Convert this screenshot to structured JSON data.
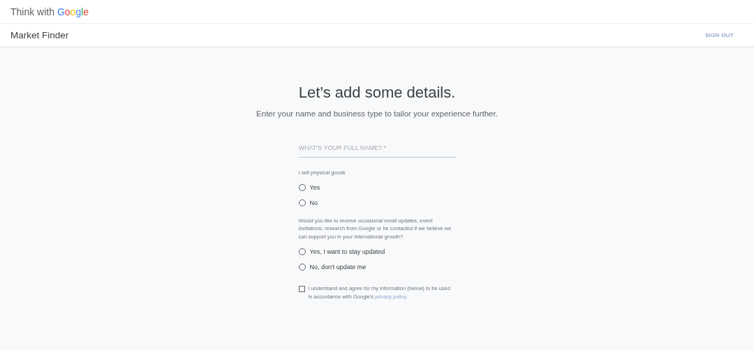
{
  "brand": {
    "prefix": "Think with",
    "name": "Google"
  },
  "app_bar": {
    "title": "Market Finder",
    "sign_out": "SIGN OUT"
  },
  "heading": "Let’s add some details.",
  "subheading": "Enter your name and business type to tailor your experience further.",
  "name_field": {
    "placeholder": "WHAT'S YOUR FULL NAME? *"
  },
  "goods_question": {
    "label": "I sell physical goods",
    "options": [
      {
        "label": "Yes",
        "selected": false
      },
      {
        "label": "No",
        "selected": false
      }
    ]
  },
  "updates_question": {
    "label": "Would you like to receive occasional email updates, event invitations, research from Google or be contacted if we believe we can support you in your international growth?",
    "options": [
      {
        "label": "Yes, I want to stay updated",
        "selected": false
      },
      {
        "label": "No, don't update me",
        "selected": false
      }
    ]
  },
  "consent": {
    "checked": false,
    "text": "I understand and agree for my information (below) to be used in accordance with Google's",
    "link": "privacy policy",
    "after": "."
  }
}
